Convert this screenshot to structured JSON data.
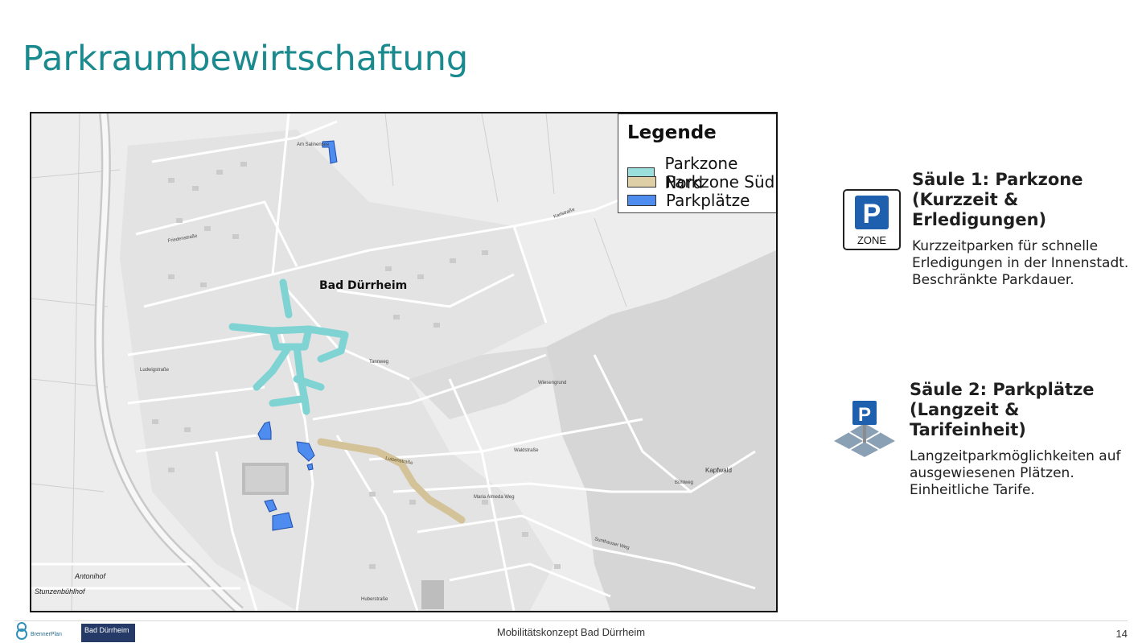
{
  "slide": {
    "title": "Parkraumbewirtschaftung",
    "footer": "Mobilitätskonzept Bad Dürrheim",
    "page_number": "14"
  },
  "map": {
    "town_label": "Bad Dürrheim",
    "street_labels": {
      "stunzenbuehlhof": "Stunzenbühlhof",
      "antonihof": "Antonihof",
      "kapfwald": "Kapfwald",
      "karlstrasse": "Karlstraße",
      "ludwigstrasse": "Ludwigstraße",
      "friedenstrasse": "Friedenstraße",
      "waldstrasse": "Waldstraße",
      "hubertstrasse": "Huberstraße",
      "luisenstrasse": "Luisenstraße",
      "maria_almeda_weg": "Maria Almeda Weg",
      "sunthauser_weg": "Sunthauser Weg",
      "am_salinensee": "Am Salinensee",
      "wiesengrund": "Wiesengrund",
      "buehlweg": "Bühlweg",
      "tannweg": "Tannweg"
    },
    "colors": {
      "parkzone_nord": "#7fd3d3",
      "parkzone_sued": "#d4c299",
      "parkplaetze": "#4e8cf0",
      "background": "#ececec",
      "forest": "#d9d9d9"
    }
  },
  "legend": {
    "title": "Legende",
    "items": [
      {
        "label": "Parkzone Nord",
        "color": "#9adfdc"
      },
      {
        "label": "Parkzone Süd",
        "color": "#dfcfa6"
      },
      {
        "label": "Parkplätze",
        "color": "#4e8cf0"
      }
    ]
  },
  "pillars": [
    {
      "title_line1": "Säule 1: Parkzone",
      "title_line2": "(Kurzzeit & Erledigungen)",
      "desc_lines": [
        "Kurzzeitparken für schnelle",
        "Erledigungen in der Innenstadt.",
        "Beschränkte Parkdauer."
      ],
      "icon": "parking-zone-sign-icon",
      "icon_text": "P",
      "icon_subtext": "ZONE"
    },
    {
      "title_line1": "Säule 2: Parkplätze",
      "title_line2": "(Langzeit & Tarifeinheit)",
      "desc_lines": [
        "Langzeitparkmöglichkeiten auf",
        "ausgewiesenen Plätzen.",
        "Einheitliche Tarife."
      ],
      "icon": "parking-lot-icon",
      "icon_text": "P"
    }
  ],
  "logos": {
    "brennerplan": "BrennerPlan",
    "bad_duerrheim": "Bad Dürrheim"
  }
}
